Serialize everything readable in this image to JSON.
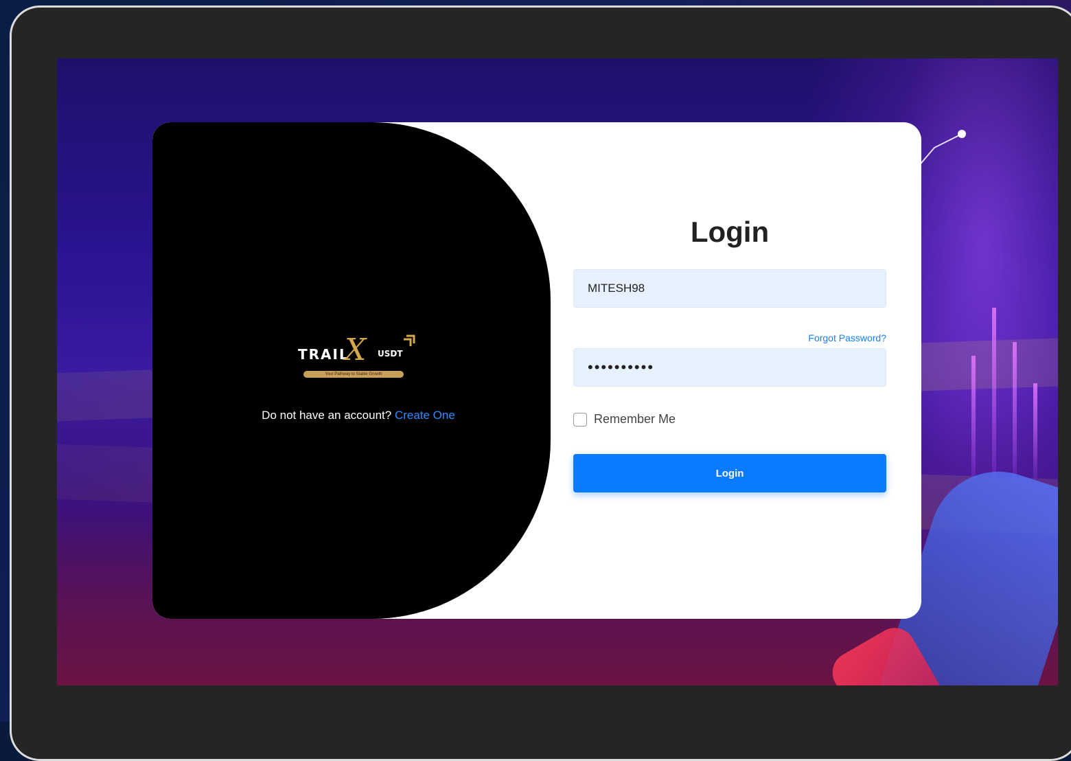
{
  "login": {
    "title": "Login",
    "username_value": "MITESH98",
    "password_value": "••••••••••",
    "forgot_label": "Forgot Password?",
    "remember_label": "Remember Me",
    "remember_checked": false,
    "submit_label": "Login"
  },
  "signup": {
    "prompt": "Do not have an account?",
    "link": "Create One"
  },
  "brand": {
    "name_part1": "TRAIL",
    "name_part2": "X",
    "name_part3": "USDT",
    "tagline": "Your Pathway to Stable Growth",
    "gold": "#d4a84b"
  },
  "theme": {
    "accent": "#0a7bff",
    "input_bg": "#e7f0fd"
  }
}
